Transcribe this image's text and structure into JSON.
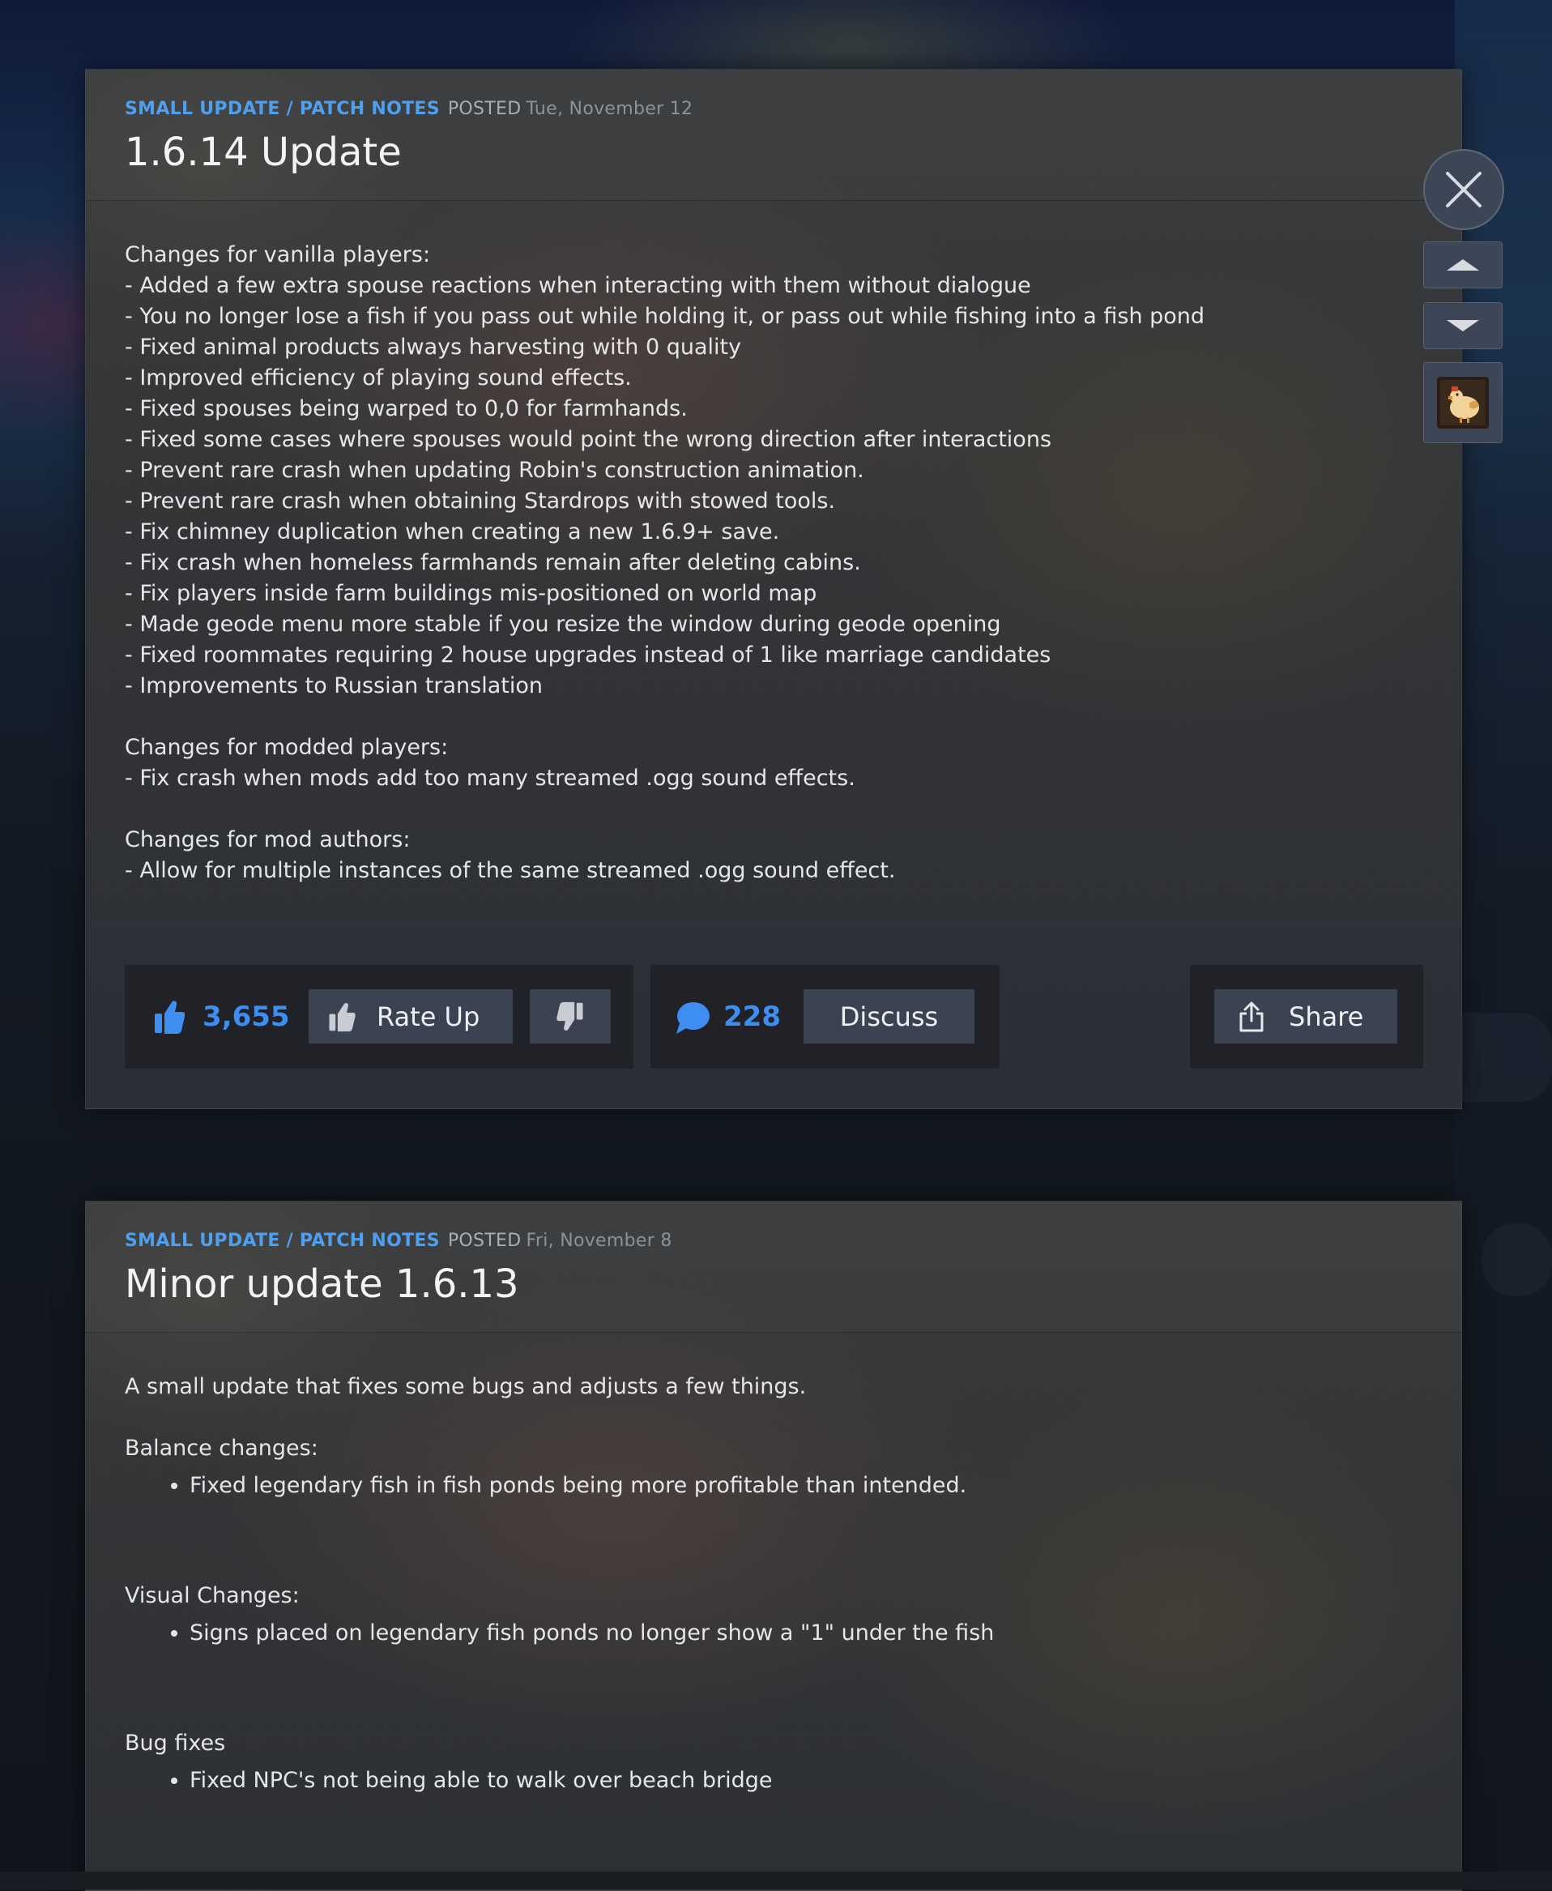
{
  "posts": [
    {
      "type": "SMALL UPDATE / PATCH NOTES",
      "posted_label": "POSTED",
      "date": "Tue, November 12",
      "title": "1.6.14 Update",
      "sections": [
        {
          "heading": "Changes for vanilla players:",
          "lines": [
            "- Added a few extra spouse reactions when interacting with them without dialogue",
            "- You no longer lose a fish if you pass out while holding it, or pass out while fishing into a fish pond",
            "- Fixed animal products always harvesting with 0 quality",
            "- Improved efficiency of playing sound effects.",
            "- Fixed spouses being warped to 0,0 for farmhands.",
            "- Fixed some cases where spouses would point the wrong direction after interactions",
            "- Prevent rare crash when updating Robin's construction animation.",
            "- Prevent rare crash when obtaining Stardrops with stowed tools.",
            "- Fix chimney duplication when creating a new 1.6.9+ save.",
            "- Fix crash when homeless farmhands remain after deleting cabins.",
            "- Fix players inside farm buildings mis-positioned on world map",
            "- Made geode menu more stable if you resize the window during geode opening",
            "- Fixed roommates requiring 2 house upgrades instead of 1 like marriage candidates",
            "- Improvements to Russian translation"
          ]
        },
        {
          "heading": "Changes for modded players:",
          "lines": [
            "- Fix crash when mods add too many streamed .ogg sound effects."
          ]
        },
        {
          "heading": "Changes for mod authors:",
          "lines": [
            "- Allow for multiple instances of the same streamed .ogg sound effect."
          ]
        }
      ],
      "footer": {
        "rate_count": "3,655",
        "rate_up_label": "Rate Up",
        "comment_count": "228",
        "discuss_label": "Discuss",
        "share_label": "Share"
      }
    },
    {
      "type": "SMALL UPDATE / PATCH NOTES",
      "posted_label": "POSTED",
      "date": "Fri, November 8",
      "title": "Minor update 1.6.13",
      "intro": "A small update that fixes some bugs and adjusts a few things.",
      "sections": [
        {
          "heading": "Balance changes:",
          "items": [
            "Fixed legendary fish in fish ponds being more profitable than intended."
          ]
        },
        {
          "heading": "Visual Changes:",
          "items": [
            "Signs placed on legendary fish ponds no longer show a \"1\" under the fish"
          ]
        },
        {
          "heading": "Bug fixes",
          "items": [
            "Fixed NPC's not being able to walk over beach bridge"
          ]
        }
      ]
    }
  ],
  "side_controls": {
    "close_icon": "close-icon",
    "prev_icon": "chevron-up-icon",
    "next_icon": "chevron-down-icon",
    "app_icon": "game-icon"
  },
  "colors": {
    "accent": "#4f9ff0",
    "count_blue": "#3d8ef0",
    "button_bg": "#3b4251"
  }
}
